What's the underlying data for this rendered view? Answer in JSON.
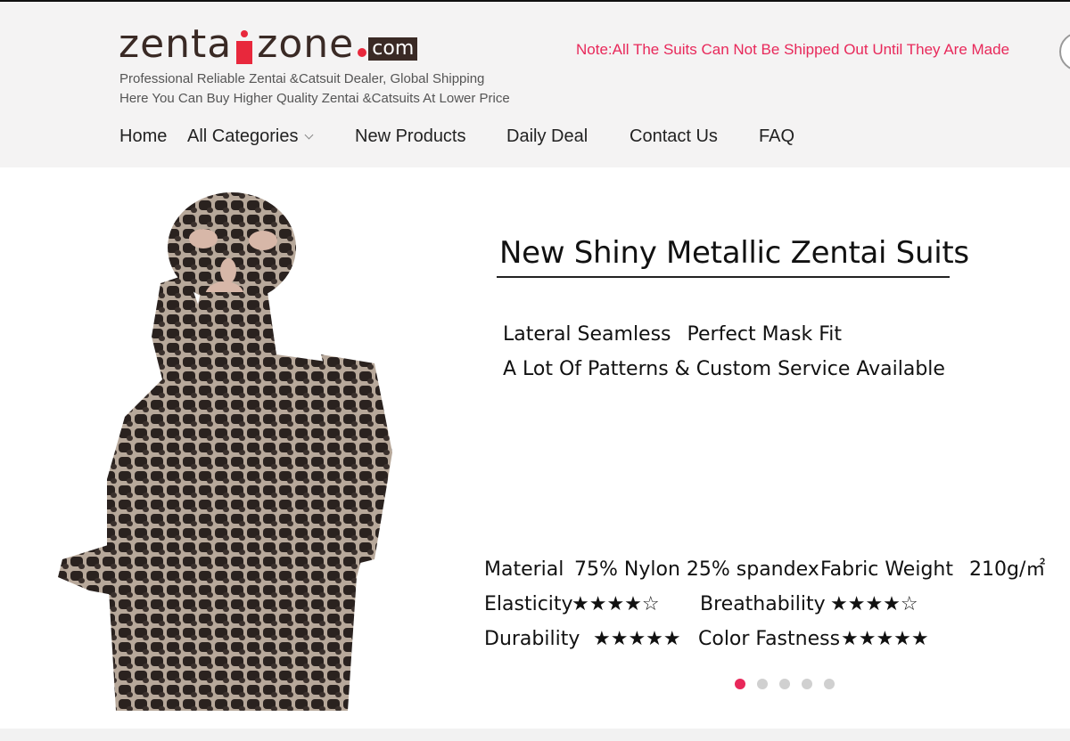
{
  "header": {
    "logo": {
      "part1": "zenta",
      "part2": "zone",
      "suffix": "com"
    },
    "tagline_1": "Professional Reliable Zentai &Catsuit Dealer, Global Shipping",
    "tagline_2": "Here You Can Buy Higher Quality Zentai &Catsuits At Lower Price",
    "note": "Note:All The Suits Can Not Be Shipped Out Until They Are Made",
    "accent_color": "#e8285a"
  },
  "nav": {
    "items": [
      {
        "label": "Home"
      },
      {
        "label": "All Categories",
        "has_dropdown": true
      },
      {
        "label": "New Products"
      },
      {
        "label": "Daily Deal"
      },
      {
        "label": "Contact Us"
      },
      {
        "label": "FAQ"
      }
    ]
  },
  "banner": {
    "headline": "New Shiny Metallic Zentai Suits",
    "feature_1a": "Lateral Seamless",
    "feature_1b": "Perfect Mask Fit",
    "feature_2": "A Lot Of Patterns & Custom Service Available",
    "specs": {
      "material_label": "Material",
      "material_value": "75% Nylon 25% spandex",
      "weight_label": "Fabric Weight",
      "weight_value": "210g/㎡",
      "elasticity_label": "Elasticity",
      "elasticity_stars": "★★★★☆",
      "breathability_label": "Breathability",
      "breathability_stars": "★★★★☆",
      "durability_label": "Durability",
      "durability_stars": "★★★★★",
      "color_label": "Color Fastness",
      "color_stars": "★★★★★"
    },
    "carousel": {
      "slides": 5,
      "active": 1
    }
  }
}
